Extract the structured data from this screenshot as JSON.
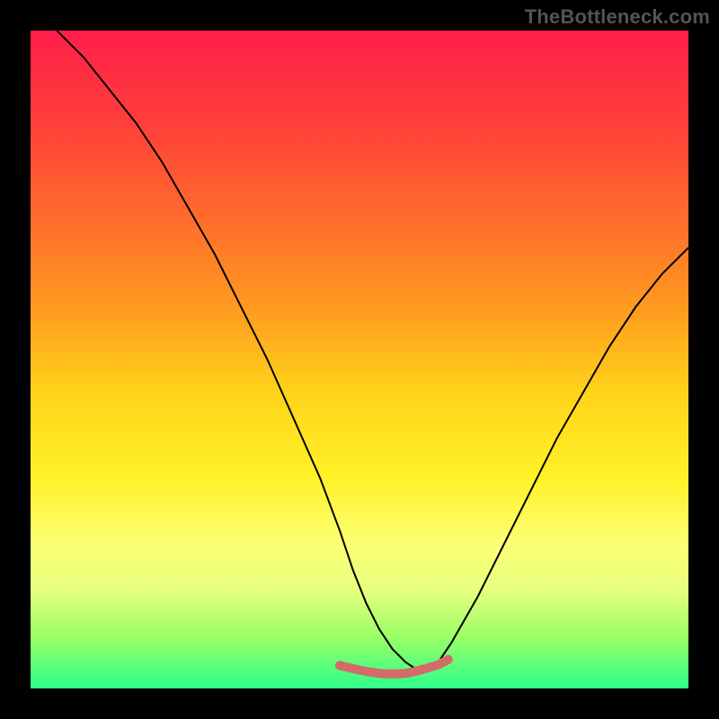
{
  "watermark": "TheBottleneck.com",
  "chart_data": {
    "type": "line",
    "title": "",
    "xlabel": "",
    "ylabel": "",
    "xlim": [
      0,
      100
    ],
    "ylim": [
      0,
      100
    ],
    "grid": false,
    "legend": false,
    "series": [
      {
        "name": "primary-curve",
        "stroke": "#000000",
        "width": 2,
        "x": [
          4,
          8,
          12,
          16,
          20,
          24,
          28,
          32,
          36,
          40,
          44,
          47,
          49,
          51,
          53,
          55,
          57,
          58.5,
          60,
          62,
          64,
          68,
          72,
          76,
          80,
          84,
          88,
          92,
          96,
          100
        ],
        "y": [
          100,
          96,
          91,
          86,
          80,
          73,
          66,
          58,
          50,
          41,
          32,
          24,
          18,
          13,
          9,
          6,
          4,
          3,
          3,
          4,
          7,
          14,
          22,
          30,
          38,
          45,
          52,
          58,
          63,
          67
        ]
      },
      {
        "name": "trough-highlight",
        "stroke": "#d46a6a",
        "width": 10,
        "x": [
          47,
          49,
          51,
          53,
          55,
          57,
          58.5,
          60,
          62,
          63.5
        ],
        "y": [
          3.5,
          3.0,
          2.6,
          2.3,
          2.2,
          2.3,
          2.6,
          3.0,
          3.6,
          4.4
        ]
      }
    ]
  }
}
